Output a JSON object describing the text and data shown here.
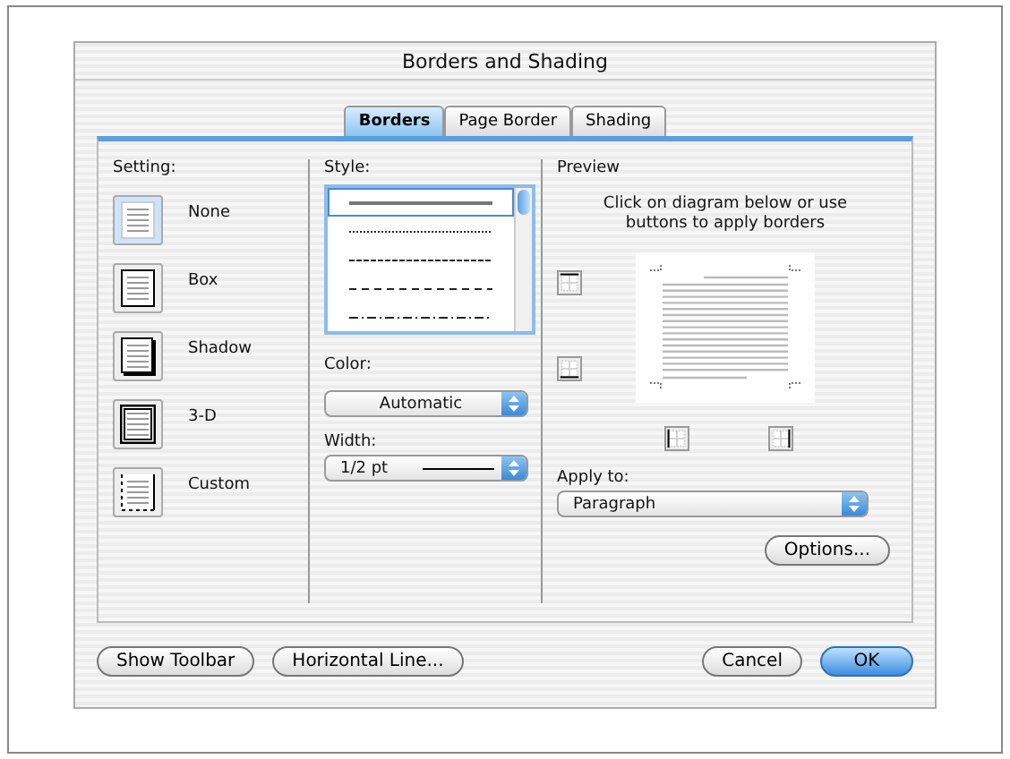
{
  "window": {
    "title": "Borders and Shading"
  },
  "tabs": [
    {
      "label": "Borders",
      "selected": true
    },
    {
      "label": "Page Border",
      "selected": false
    },
    {
      "label": "Shading",
      "selected": false
    }
  ],
  "setting": {
    "label": "Setting:",
    "items": [
      {
        "kind": "none",
        "label": "None",
        "selected": true
      },
      {
        "kind": "box",
        "label": "Box",
        "selected": false
      },
      {
        "kind": "shadow",
        "label": "Shadow",
        "selected": false
      },
      {
        "kind": "framed",
        "label": "3-D",
        "selected": false
      },
      {
        "kind": "custom",
        "label": "Custom",
        "selected": false
      }
    ]
  },
  "style": {
    "label": "Style:",
    "items": [
      {
        "kind": "solid",
        "selected": true
      },
      {
        "kind": "dotted",
        "selected": false
      },
      {
        "kind": "dashed",
        "selected": false
      },
      {
        "kind": "wide-dashed",
        "selected": false
      },
      {
        "kind": "dash-dot",
        "selected": false
      }
    ]
  },
  "color": {
    "label": "Color:",
    "value": "Automatic"
  },
  "width": {
    "label": "Width:",
    "value": "1/2 pt"
  },
  "preview": {
    "label": "Preview",
    "hint": "Click on diagram below or use buttons to apply borders"
  },
  "apply_to": {
    "label": "Apply to:",
    "value": "Paragraph"
  },
  "options_button": "Options...",
  "footer": {
    "left": [
      "Show Toolbar",
      "Horizontal Line..."
    ],
    "cancel": "Cancel",
    "ok": "OK"
  }
}
